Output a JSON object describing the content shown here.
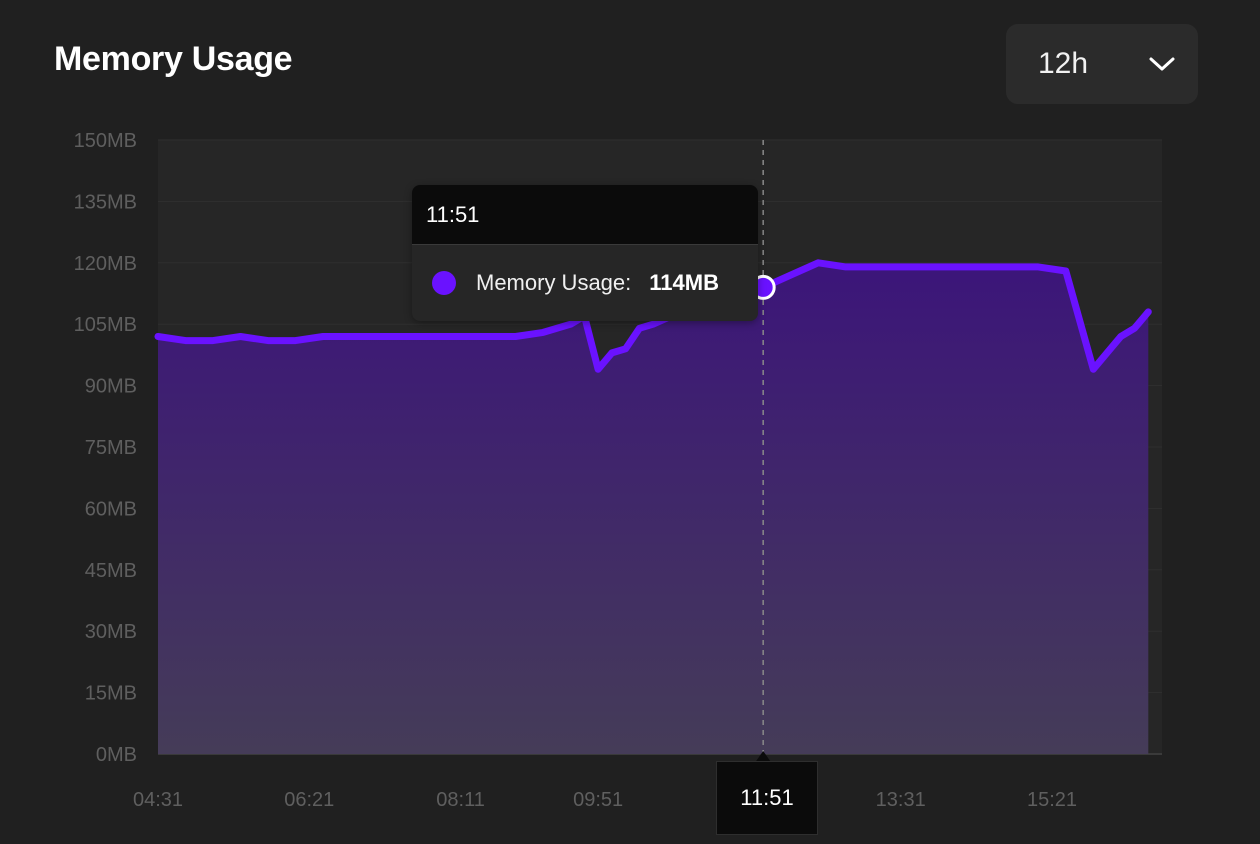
{
  "header": {
    "title": "Memory Usage",
    "range_value": "12h",
    "range_icon": "chevron-down-icon"
  },
  "colors": {
    "background": "#202020",
    "plot_background": "#262626",
    "line": "#6a12ff",
    "area_top": "#3c157a",
    "area_bottom": "#453c58"
  },
  "tooltip": {
    "time": "11:51",
    "series_label": "Memory Usage:",
    "value": "114MB"
  },
  "hover_x_label": "11:51",
  "chart_data": {
    "type": "area",
    "title": "Memory Usage",
    "unit": "MB",
    "ylim": [
      0,
      150
    ],
    "y_ticks": [
      "0MB",
      "15MB",
      "30MB",
      "45MB",
      "60MB",
      "75MB",
      "90MB",
      "105MB",
      "120MB",
      "135MB",
      "150MB"
    ],
    "x_ticks": [
      "04:31",
      "06:21",
      "08:11",
      "09:51",
      "11:51",
      "13:31",
      "15:21"
    ],
    "grid": true,
    "legend": "none",
    "series": [
      {
        "name": "Memory Usage",
        "x": [
          "04:31",
          "04:51",
          "05:11",
          "05:31",
          "05:51",
          "06:11",
          "06:31",
          "06:51",
          "07:11",
          "07:31",
          "07:51",
          "08:11",
          "08:31",
          "08:51",
          "09:11",
          "09:31",
          "09:41",
          "09:51",
          "10:01",
          "10:11",
          "10:21",
          "10:31",
          "10:51",
          "11:11",
          "11:31",
          "11:51",
          "12:11",
          "12:31",
          "12:51",
          "13:11",
          "13:31",
          "13:51",
          "14:11",
          "14:31",
          "14:51",
          "15:11",
          "15:31",
          "15:51",
          "16:01",
          "16:11",
          "16:21",
          "16:31"
        ],
        "values": [
          102,
          101,
          101,
          102,
          101,
          101,
          102,
          102,
          102,
          102,
          102,
          102,
          102,
          102,
          103,
          105,
          107,
          94,
          98,
          99,
          104,
          105,
          108,
          111,
          112,
          114,
          117,
          120,
          119,
          119,
          119,
          119,
          119,
          119,
          119,
          119,
          118,
          94,
          98,
          102,
          104,
          108
        ]
      }
    ],
    "highlight": {
      "x": "11:51",
      "value": 114
    }
  }
}
